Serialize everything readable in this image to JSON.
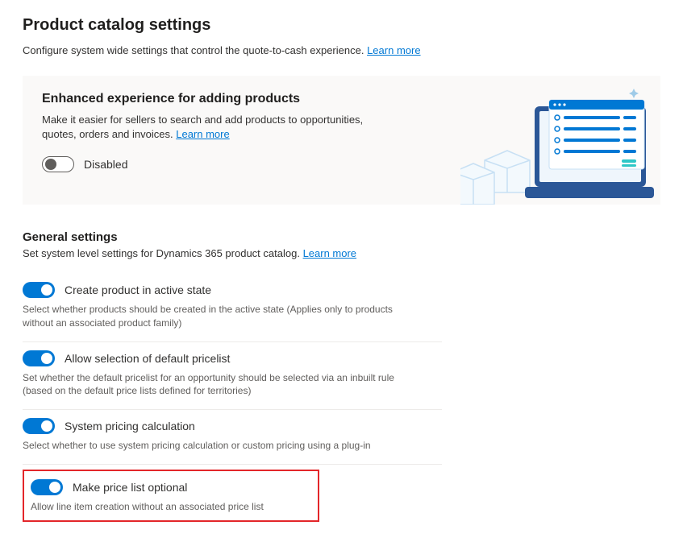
{
  "page": {
    "title": "Product catalog settings",
    "description": "Configure system wide settings that control the quote-to-cash experience.",
    "learn_more": "Learn more"
  },
  "hero": {
    "title": "Enhanced experience for adding products",
    "description": "Make it easier for sellers to search and add products to opportunities, quotes, orders and invoices.",
    "learn_more": "Learn more",
    "toggle_status": "Disabled",
    "toggle_on": false
  },
  "general": {
    "title": "General settings",
    "description": "Set system level settings for Dynamics 365 product catalog.",
    "learn_more": "Learn more",
    "items": [
      {
        "label": "Create product in active state",
        "help": "Select whether products should be created in the active state (Applies only to products without an associated product family)",
        "on": true
      },
      {
        "label": "Allow selection of default pricelist",
        "help": "Set whether the default pricelist for an opportunity should be selected via an inbuilt rule (based on the default price lists defined for territories)",
        "on": true
      },
      {
        "label": "System pricing calculation",
        "help": "Select whether to use system pricing calculation or custom pricing using a plug-in",
        "on": true
      },
      {
        "label": "Make price list optional",
        "help": "Allow line item creation without an associated price list",
        "on": true
      }
    ]
  }
}
